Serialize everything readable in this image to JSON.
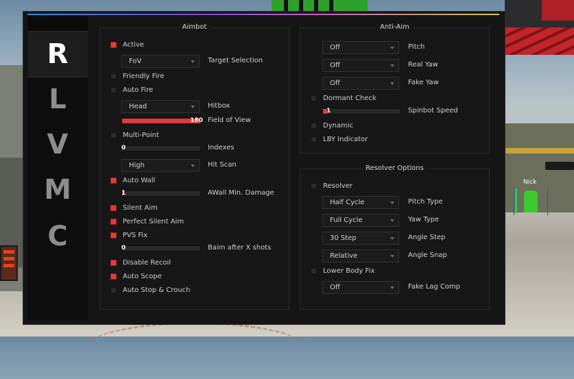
{
  "tabs": [
    "R",
    "L",
    "V",
    "M",
    "C"
  ],
  "esp": {
    "player_name": "Nick"
  },
  "aimbot": {
    "title": "Aimbot",
    "active": {
      "label": "Active",
      "checked": true
    },
    "target_selection": {
      "value": "FoV",
      "label": "Target Selection"
    },
    "friendly_fire": {
      "label": "Friendly Fire",
      "checked": false
    },
    "auto_fire": {
      "label": "Auto Fire",
      "checked": false
    },
    "hitbox": {
      "value": "Head",
      "label": "Hitbox"
    },
    "field_of_view": {
      "label": "Field of View",
      "value": "180",
      "fraction": 1.0
    },
    "multi_point": {
      "label": "Multi-Point",
      "checked": false
    },
    "indexes": {
      "label": "Indexes",
      "value": "0",
      "fraction": 0
    },
    "hit_scan": {
      "value": "High",
      "label": "Hit Scan"
    },
    "auto_wall": {
      "label": "Auto Wall",
      "checked": true
    },
    "awall_min_damage": {
      "label": "AWall Min. Damage",
      "value": "1",
      "fraction": 0.01
    },
    "silent_aim": {
      "label": "Silent Aim",
      "checked": true
    },
    "perfect_silent_aim": {
      "label": "Perfect Silent Aim",
      "checked": true
    },
    "pvs_fix": {
      "label": "PVS Fix",
      "checked": true
    },
    "baim_after_x_shots": {
      "label": "Baim after X shots",
      "value": "0",
      "fraction": 0
    },
    "disable_recoil": {
      "label": "Disable Recoil",
      "checked": true
    },
    "auto_scope": {
      "label": "Auto Scope",
      "checked": true
    },
    "auto_stop_crouch": {
      "label": "Auto Stop & Crouch",
      "checked": false
    }
  },
  "antiaim": {
    "title": "Anti-Aim",
    "pitch": {
      "value": "Off",
      "label": "Pitch"
    },
    "real_yaw": {
      "value": "Off",
      "label": "Real Yaw"
    },
    "fake_yaw": {
      "value": "Off",
      "label": "Fake Yaw"
    },
    "dormant_check": {
      "label": "Dormant Check",
      "checked": false
    },
    "spinbot_speed": {
      "label": "Spinbot Speed",
      "value": "1",
      "fraction": 0.05
    },
    "dynamic": {
      "label": "Dynamic",
      "checked": false
    },
    "lby_indicator": {
      "label": "LBY Indicator",
      "checked": false
    }
  },
  "resolver": {
    "title": "Resolver Options",
    "resolver": {
      "label": "Resolver",
      "checked": false
    },
    "pitch_type": {
      "value": "Half Cycle",
      "label": "Pitch Type"
    },
    "yaw_type": {
      "value": "Full Cycle",
      "label": "Yaw Type"
    },
    "angle_step": {
      "value": "30 Step",
      "label": "Angle Step"
    },
    "angle_snap": {
      "value": "Relative",
      "label": "Angle Snap"
    },
    "lower_body_fix": {
      "label": "Lower Body Fix",
      "checked": false
    },
    "fake_lag_comp": {
      "value": "Off",
      "label": "Fake Lag Comp"
    }
  },
  "colors": {
    "accent": "#e03a3a",
    "panel": "#171717",
    "background": "#151515"
  }
}
